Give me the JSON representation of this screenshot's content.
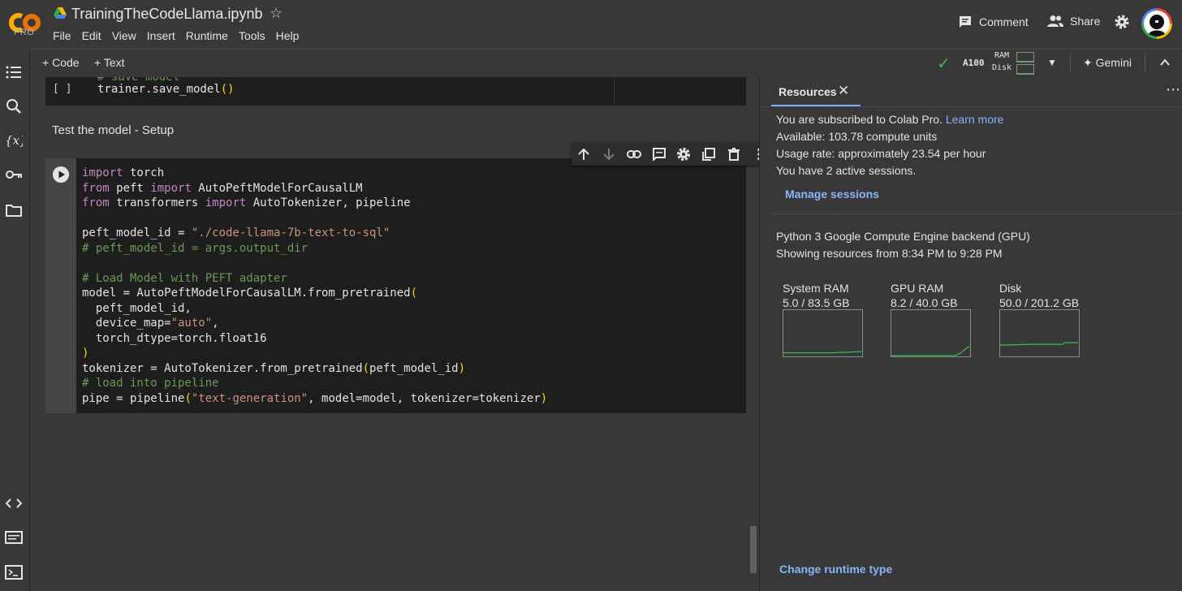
{
  "header": {
    "logo_text": "CO",
    "plan_badge": "PRO",
    "notebook_title": "TrainingTheCodeLlama.ipynb",
    "menu": [
      "File",
      "Edit",
      "View",
      "Insert",
      "Runtime",
      "Tools",
      "Help"
    ],
    "comment_label": "Comment",
    "share_label": "Share"
  },
  "toolbar": {
    "add_code_label": "+ Code",
    "add_text_label": "+ Text",
    "accelerator": "A100",
    "ram_label": "RAM",
    "disk_label": "Disk",
    "gemini_label": "Gemini",
    "connected": true
  },
  "sidebar": {
    "icons": [
      "table-of-contents-icon",
      "search-icon",
      "variables-icon",
      "secrets-key-icon",
      "files-icon",
      "code-snippets-icon",
      "command-palette-icon",
      "terminal-icon"
    ]
  },
  "notebook": {
    "cell1": {
      "run_label": "[ ]",
      "prev_line": "# save model",
      "code": "trainer.save_model()"
    },
    "text_cell": "Test the model - Setup",
    "cell2": {
      "lines": [
        "import torch",
        "from peft import AutoPeftModelForCausalLM",
        "from transformers import AutoTokenizer, pipeline",
        "",
        "peft_model_id = \"./code-llama-7b-text-to-sql\"",
        "# peft_model_id = args.output_dir",
        "",
        "# Load Model with PEFT adapter",
        "model = AutoPeftModelForCausalLM.from_pretrained(",
        "  peft_model_id,",
        "  device_map=\"auto\",",
        "  torch_dtype=torch.float16",
        ")",
        "tokenizer = AutoTokenizer.from_pretrained(peft_model_id)",
        "# load into pipeline",
        "pipe = pipeline(\"text-generation\", model=model, tokenizer=tokenizer)"
      ]
    },
    "cell_toolbar_icons": [
      "move-up-icon",
      "move-down-icon",
      "link-icon",
      "comment-icon",
      "settings-icon",
      "mirror-cell-icon",
      "delete-icon",
      "more-icon"
    ]
  },
  "resources": {
    "tab_label": "Resources",
    "subscription_text": "You are subscribed to Colab Pro.",
    "learn_more": "Learn more",
    "available": "Available: 103.78 compute units",
    "usage_rate": "Usage rate: approximately 23.54 per hour",
    "sessions": "You have 2 active sessions.",
    "manage_sessions": "Manage sessions",
    "backend": "Python 3 Google Compute Engine backend (GPU)",
    "time_range": "Showing resources from 8:34 PM to 9:28 PM",
    "gauges": [
      {
        "name": "System RAM",
        "value": "5.0 / 83.5 GB",
        "fraction": 0.06
      },
      {
        "name": "GPU RAM",
        "value": "8.2 / 40.0 GB",
        "fraction": 0.205
      },
      {
        "name": "Disk",
        "value": "50.0 / 201.2 GB",
        "fraction": 0.248
      }
    ],
    "change_runtime": "Change runtime type"
  },
  "colors": {
    "background": "#383838",
    "cell_background": "#1e1e1e",
    "keyword": "#c586c0",
    "string": "#ce9178",
    "comment": "#6a9955",
    "link": "#8ab4f8",
    "gauge_line": "#3fb950"
  }
}
